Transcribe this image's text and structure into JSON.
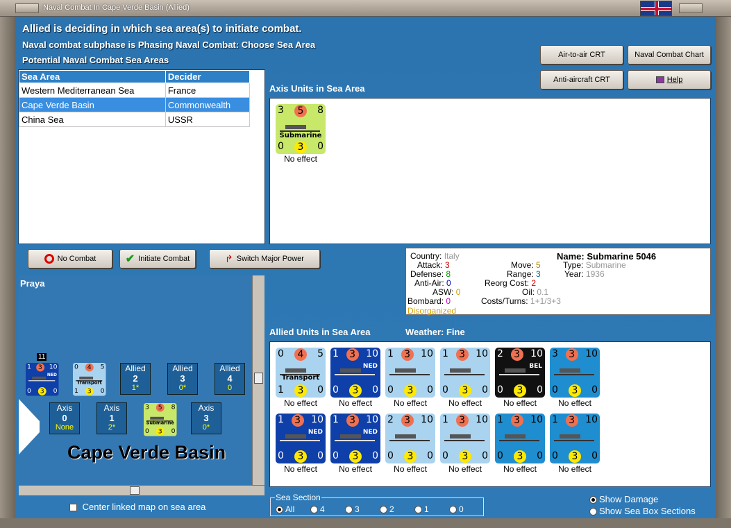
{
  "window": {
    "title": "Naval Combat In Cape Verde Basin (Allied)"
  },
  "header": {
    "line1": "Allied is deciding in which sea area(s) to initiate combat.",
    "line2": "Naval combat subphase is Phasing Naval Combat: Choose Sea Area",
    "line3": "Potential Naval Combat Sea Areas"
  },
  "buttons": {
    "air_to_air": "Air-to-air CRT",
    "naval_chart": "Naval Combat Chart",
    "anti_aircraft": "Anti-aircraft CRT",
    "help": "Help",
    "no_combat": "No Combat",
    "initiate_combat": "Initiate Combat",
    "switch_major": "Switch Major Power"
  },
  "sea_table": {
    "headers": [
      "Sea Area",
      "Decider"
    ],
    "rows": [
      {
        "area": "Western Mediterranean Sea",
        "decider": "France"
      },
      {
        "area": "Cape Verde Basin",
        "decider": "Commonwealth"
      },
      {
        "area": "China Sea",
        "decider": "USSR"
      }
    ]
  },
  "axis_panel": {
    "title": "Axis Units in Sea Area",
    "unit": {
      "top": [
        "3",
        "5",
        "8"
      ],
      "name": "Submarine",
      "bottom": [
        "0",
        "3",
        "0"
      ],
      "effect": "No effect"
    }
  },
  "info": {
    "country_label": "Country:",
    "country": "Italy",
    "attack_label": "Attack:",
    "attack": "3",
    "defense_label": "Defense:",
    "defense": "8",
    "antiair_label": "Anti-Air:",
    "antiair": "0",
    "asw_label": "ASW:",
    "asw": "0",
    "bombard_label": "Bombard:",
    "bombard": "0",
    "status": "Disorganized",
    "move_label": "Move:",
    "move": "5",
    "range_label": "Range:",
    "range": "3",
    "reorg_label": "Reorg Cost:",
    "reorg": "2",
    "oil_label": "Oil:",
    "oil": "0.1",
    "costs_label": "Costs/Turns:",
    "costs": "1+1/3+3",
    "name_label": "Name:",
    "name": "Submarine 5046",
    "type_label": "Type:",
    "type": "Submarine",
    "year_label": "Year:",
    "year": "1936"
  },
  "allied_panel": {
    "title": "Allied Units in Sea Area",
    "weather": "Weather:  Fine",
    "units": [
      {
        "top": [
          "0",
          "4",
          "5"
        ],
        "name": "Transport",
        "nat": "",
        "bottom": [
          "1",
          "3",
          "0"
        ],
        "effect": "No effect",
        "bg": "#a9d3ef"
      },
      {
        "top": [
          "1",
          "3",
          "10"
        ],
        "name": "",
        "nat": "NED",
        "bottom": [
          "0",
          "3",
          "0"
        ],
        "effect": "No effect",
        "bg": "#0f3fa8"
      },
      {
        "top": [
          "1",
          "3",
          "10"
        ],
        "name": "",
        "nat": "",
        "bottom": [
          "0",
          "3",
          "0"
        ],
        "effect": "No effect",
        "bg": "#a9d3ef"
      },
      {
        "top": [
          "1",
          "3",
          "10"
        ],
        "name": "",
        "nat": "",
        "bottom": [
          "0",
          "3",
          "0"
        ],
        "effect": "No effect",
        "bg": "#a9d3ef"
      },
      {
        "top": [
          "2",
          "3",
          "10"
        ],
        "name": "",
        "nat": "BEL",
        "bottom": [
          "0",
          "3",
          "0"
        ],
        "effect": "No effect",
        "bg": "#111111"
      },
      {
        "top": [
          "3",
          "3",
          "10"
        ],
        "name": "",
        "nat": "",
        "bottom": [
          "0",
          "3",
          "0"
        ],
        "effect": "No effect",
        "bg": "#1f8ed0"
      },
      {
        "top": [
          "1",
          "3",
          "10"
        ],
        "name": "",
        "nat": "NED",
        "bottom": [
          "0",
          "3",
          "0"
        ],
        "effect": "No effect",
        "bg": "#0f3fa8"
      },
      {
        "top": [
          "1",
          "3",
          "10"
        ],
        "name": "",
        "nat": "NED",
        "bottom": [
          "0",
          "3",
          "0"
        ],
        "effect": "No effect",
        "bg": "#0f3fa8"
      },
      {
        "top": [
          "2",
          "3",
          "10"
        ],
        "name": "",
        "nat": "",
        "bottom": [
          "0",
          "3",
          "0"
        ],
        "effect": "No effect",
        "bg": "#a9d3ef"
      },
      {
        "top": [
          "1",
          "3",
          "10"
        ],
        "name": "",
        "nat": "",
        "bottom": [
          "0",
          "3",
          "0"
        ],
        "effect": "No effect",
        "bg": "#a9d3ef"
      },
      {
        "top": [
          "1",
          "3",
          "10"
        ],
        "name": "",
        "nat": "",
        "bottom": [
          "0",
          "3",
          "0"
        ],
        "effect": "No effect",
        "bg": "#1f8ed0"
      },
      {
        "top": [
          "1",
          "3",
          "10"
        ],
        "name": "",
        "nat": "",
        "bottom": [
          "0",
          "3",
          "0"
        ],
        "effect": "No effect",
        "bg": "#1f8ed0"
      }
    ]
  },
  "map": {
    "place": "Praya",
    "sea_name": "Cape Verde Basin",
    "stack_count": "11",
    "allied_boxes": [
      {
        "label": "Allied",
        "num": "2",
        "val": "1*"
      },
      {
        "label": "Allied",
        "num": "3",
        "val": "0*"
      },
      {
        "label": "Allied",
        "num": "4",
        "val": "0"
      }
    ],
    "axis_boxes": [
      {
        "label": "Axis",
        "num": "0",
        "val": "None"
      },
      {
        "label": "Axis",
        "num": "1",
        "val": "2*"
      },
      {
        "label": "Axis",
        "num": "3",
        "val": "0*"
      }
    ],
    "map_counters": [
      {
        "top": [
          "1",
          "3",
          "10"
        ],
        "nat": "NED",
        "name": "",
        "bottom": [
          "0",
          "3",
          "0"
        ]
      },
      {
        "top": [
          "0",
          "4",
          "5"
        ],
        "nat": "",
        "name": "Transport",
        "bottom": [
          "1",
          "3",
          "0"
        ]
      },
      {
        "top": [
          "3",
          "5",
          "8"
        ],
        "nat": "",
        "name": "Submarine",
        "bottom": [
          "0",
          "3",
          "0"
        ]
      }
    ]
  },
  "footer": {
    "center_linked": "Center linked map on sea area",
    "sea_section": "Sea Section",
    "sections": [
      "All",
      "4",
      "3",
      "2",
      "1",
      "0"
    ],
    "show_damage": "Show Damage",
    "show_boxes": "Show Sea Box Sections"
  }
}
